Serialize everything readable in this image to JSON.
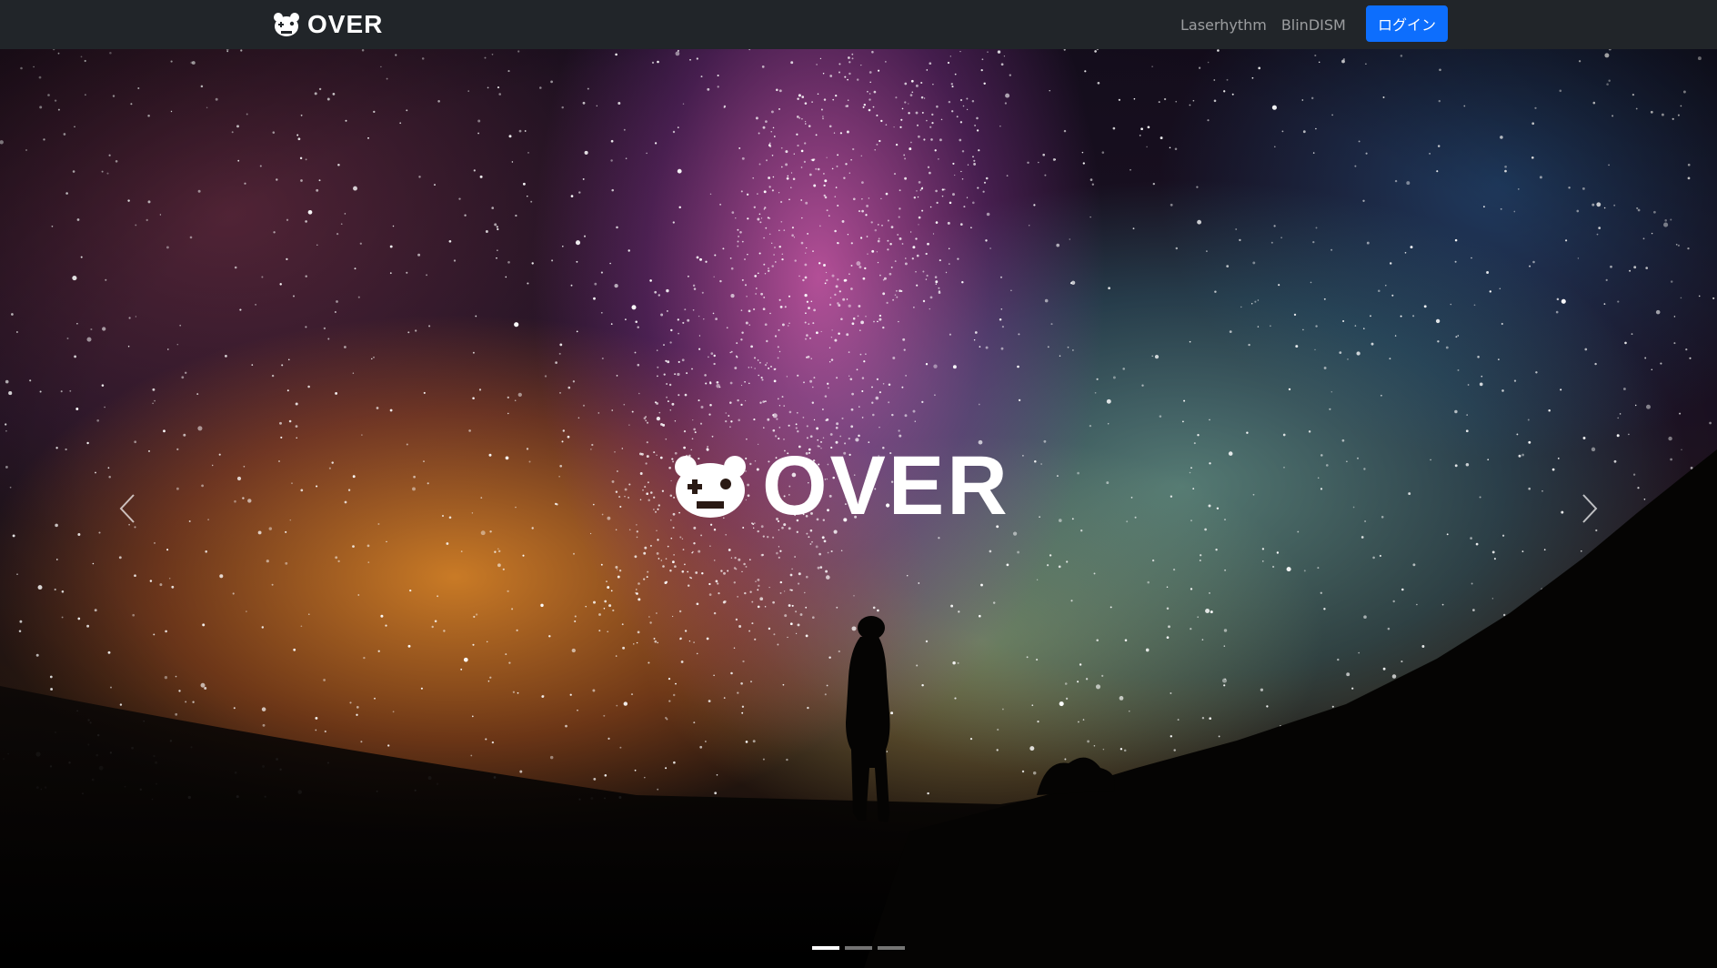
{
  "navbar": {
    "brand_text": "OVER",
    "links": [
      "Laserhythm",
      "BlinDISM"
    ],
    "login_label": "ログイン"
  },
  "hero": {
    "logo_text": "OVER",
    "slide_count": 3,
    "active_slide": 1,
    "prev_icon": "chevron-left-icon",
    "next_icon": "chevron-right-icon"
  },
  "colors": {
    "navbar_bg": "#212529",
    "primary": "#0d6efd",
    "nav_link": "rgba(255,255,255,0.55)"
  }
}
